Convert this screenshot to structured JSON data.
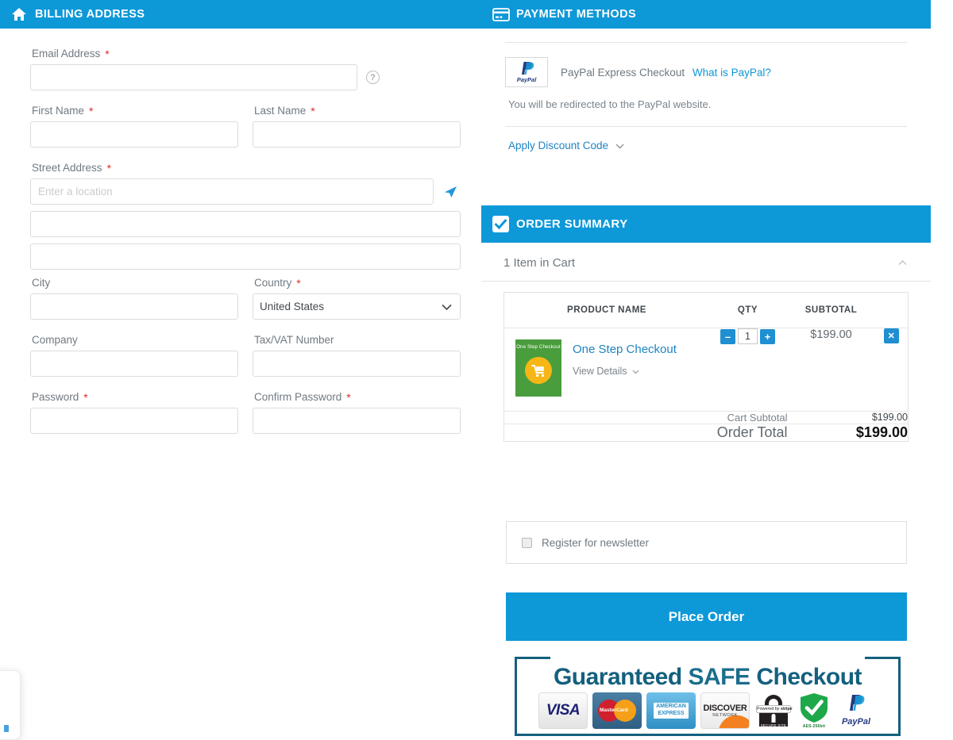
{
  "theme": {
    "accent_blue": "#0d98d8",
    "link_blue": "#1f84c4",
    "required_red": "#e02b27",
    "thumb_green": "#4a9d3d",
    "thumb_circle_orange": "#f6b716",
    "trust_border": "#14607e"
  },
  "billing": {
    "header_title": "BILLING ADDRESS",
    "header_icon": "home-icon",
    "email": {
      "label": "Email Address",
      "required": "*",
      "value": "",
      "placeholder": "",
      "help_icon": "question-mark-icon"
    },
    "first_name": {
      "label": "First Name",
      "required": "*",
      "value": "",
      "placeholder": ""
    },
    "last_name": {
      "label": "Last Name",
      "required": "*",
      "value": "",
      "placeholder": ""
    },
    "street": {
      "label": "Street Address",
      "required": "*",
      "line1_value": "",
      "line1_placeholder": "Enter a location",
      "line2_value": "",
      "line3_value": "",
      "geo_icon": "location-arrow-icon"
    },
    "city": {
      "label": "City",
      "value": "",
      "placeholder": ""
    },
    "country": {
      "label": "Country",
      "required": "*",
      "selected": "United States",
      "options": [
        "United States"
      ],
      "chevron_icon": "chevron-down-icon"
    },
    "company": {
      "label": "Company",
      "value": "",
      "placeholder": ""
    },
    "tax_vat": {
      "label": "Tax/VAT Number",
      "value": "",
      "placeholder": ""
    },
    "password": {
      "label": "Password",
      "required": "*",
      "value": "",
      "placeholder": ""
    },
    "confirm_password": {
      "label": "Confirm Password",
      "required": "*",
      "value": "",
      "placeholder": ""
    }
  },
  "payment_methods": {
    "header_title": "PAYMENT METHODS",
    "header_icon": "credit-card-icon",
    "paypal": {
      "logo_text": "PayPal",
      "label": "PayPal Express Checkout",
      "what_is_link": "What is PayPal?",
      "note": "You will be redirected to the PayPal website."
    },
    "discount": {
      "link_label": "Apply Discount Code",
      "chevron_icon": "chevron-down-icon"
    }
  },
  "order_summary": {
    "header_title": "ORDER SUMMARY",
    "header_icon": "check-square-icon",
    "cart_count_label": "1 Item in Cart",
    "collapse_icon": "chevron-up-icon",
    "columns": [
      "",
      "PRODUCT NAME",
      "QTY",
      "SUBTOTAL",
      ""
    ],
    "items": [
      {
        "thumb_text": "One Step Checkout",
        "thumb_icon": "shopping-cart-icon",
        "name": "One Step Checkout",
        "view_details_label": "View Details",
        "view_details_icon": "chevron-down-icon",
        "qty": "1",
        "qty_decrease_icon": "minus-icon",
        "qty_increase_icon": "plus-icon",
        "subtotal": "$199.00",
        "remove_icon": "close-x-icon"
      }
    ],
    "totals": [
      {
        "label": "Cart Subtotal",
        "value": "$199.00"
      }
    ],
    "grand_total": {
      "label": "Order Total",
      "value": "$199.00"
    }
  },
  "newsletter": {
    "label": "Register for newsletter",
    "checked": false
  },
  "place_order": {
    "label": "Place Order"
  },
  "trust_banner": {
    "title_part1": "Guaranteed ",
    "title_safe": "SAFE",
    "title_part2": " Checkout",
    "badges": [
      {
        "name": "visa",
        "label": "VISA"
      },
      {
        "name": "mastercard",
        "label": "MasterCard"
      },
      {
        "name": "american-express",
        "line1": "AMERICAN",
        "line2": "EXPRESS"
      },
      {
        "name": "discover",
        "line1": "DISCOVER",
        "line2": "NETWORK"
      },
      {
        "name": "stripe-secure",
        "tag_prefix": "Powered by ",
        "tag_brand": "stripe",
        "footer": "SECURE SITE"
      },
      {
        "name": "aes-shield",
        "label": "AES-256bit"
      },
      {
        "name": "paypal",
        "label": "PayPal"
      }
    ]
  }
}
